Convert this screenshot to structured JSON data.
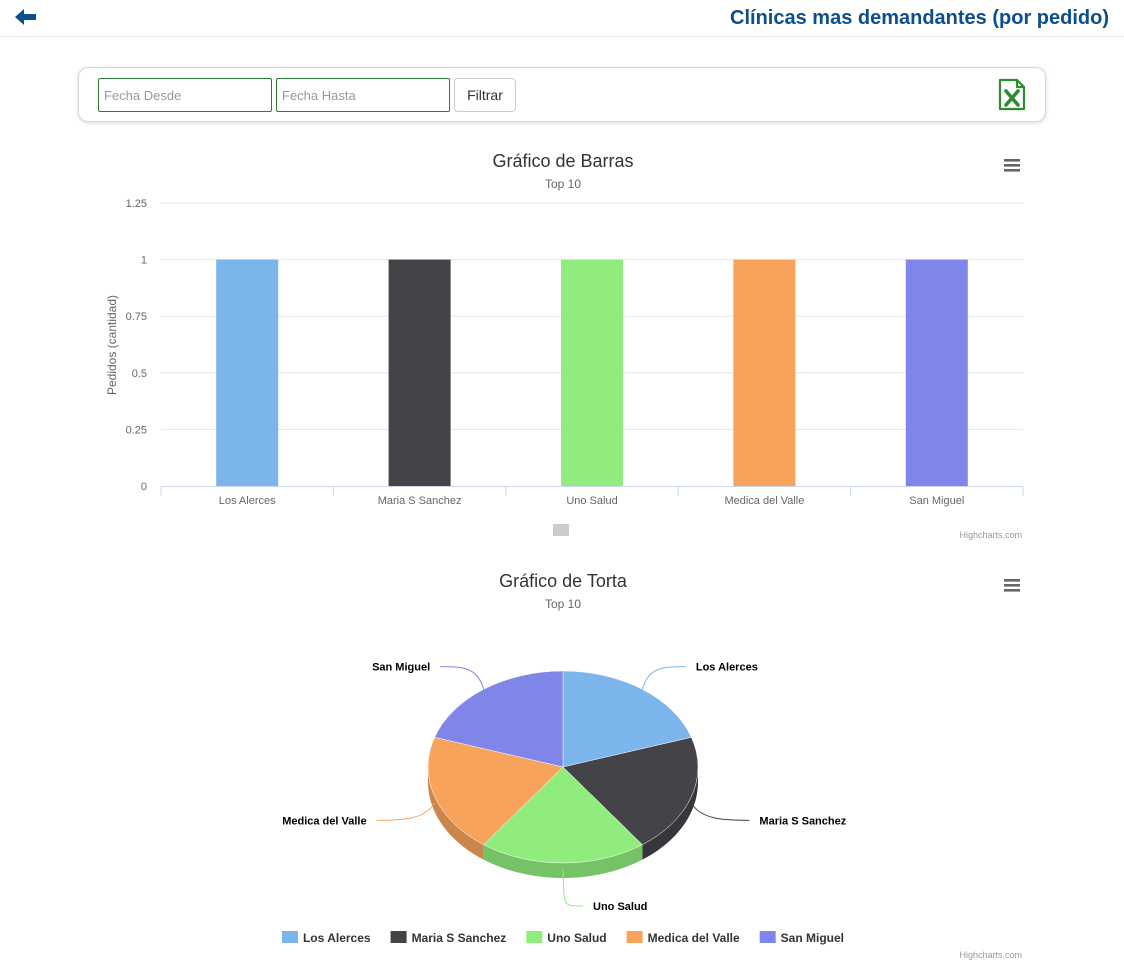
{
  "header": {
    "title": "Clínicas mas demandantes (por pedido)",
    "back_icon": "arrow-left-icon"
  },
  "filters": {
    "from_placeholder": "Fecha Desde",
    "to_placeholder": "Fecha Hasta",
    "filter_label": "Filtrar",
    "export_icon": "excel-file-icon"
  },
  "colors": {
    "header_title": "#0b4f8c",
    "input_border": "#2e7d32",
    "excel_icon": "#2e8b2e"
  },
  "credits": "Highcharts.com",
  "chart_data": [
    {
      "type": "bar",
      "title": "Gráfico de Barras",
      "subtitle": "Top 10",
      "xlabel": "",
      "ylabel": "Pedidos (cantidad)",
      "categories": [
        "Los Alerces",
        "Maria S Sanchez",
        "Uno Salud",
        "Medica del Valle",
        "San Miguel"
      ],
      "values": [
        1,
        1,
        1,
        1,
        1
      ],
      "colors": [
        "#7cb5ec",
        "#434348",
        "#90ed7d",
        "#f7a35c",
        "#8085e9"
      ],
      "ylim": [
        0,
        1.25
      ],
      "yticks": [
        "0",
        "0.25",
        "0.5",
        "0.75",
        "1",
        "1.25"
      ],
      "grid": true,
      "legend": "none"
    },
    {
      "type": "pie",
      "title": "Gráfico de Torta",
      "subtitle": "Top 10",
      "labels": [
        "Los Alerces",
        "Maria S Sanchez",
        "Uno Salud",
        "Medica del Valle",
        "San Miguel"
      ],
      "values": [
        1,
        1,
        1,
        1,
        1
      ],
      "colors": [
        "#7cb5ec",
        "#434348",
        "#90ed7d",
        "#f7a35c",
        "#8085e9"
      ],
      "style": "3d",
      "legend": "bottom"
    }
  ]
}
